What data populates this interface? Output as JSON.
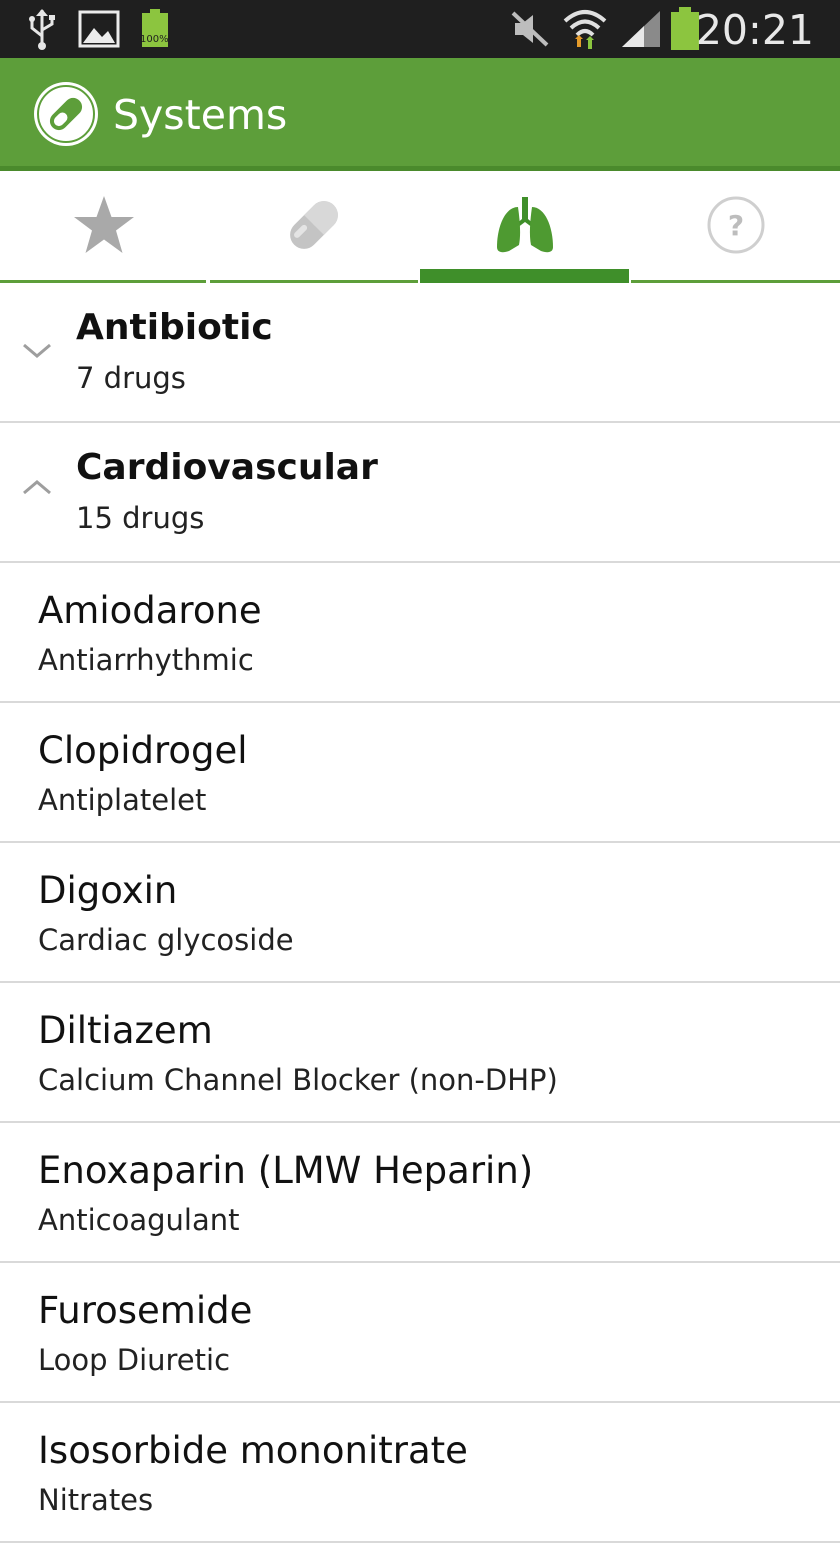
{
  "status_bar": {
    "time": "20:21",
    "battery_small_label": "100%",
    "icons": [
      "usb-icon",
      "image-icon",
      "battery-small-icon",
      "mute-icon",
      "wifi-icon",
      "signal-icon",
      "battery-icon"
    ]
  },
  "action_bar": {
    "title": "Systems",
    "logo_icon": "pill-logo-icon",
    "color": "#5d9e3a"
  },
  "tabs": [
    {
      "icon": "star-icon",
      "active": false
    },
    {
      "icon": "pill-icon",
      "active": false
    },
    {
      "icon": "lungs-icon",
      "active": true
    },
    {
      "icon": "help-icon",
      "active": false
    }
  ],
  "groups": [
    {
      "title": "Antibiotic",
      "count": "7 drugs",
      "expanded": false
    },
    {
      "title": "Cardiovascular",
      "count": "15 drugs",
      "expanded": true
    }
  ],
  "drugs": [
    {
      "name": "Amiodarone",
      "class": "Antiarrhythmic"
    },
    {
      "name": "Clopidrogel",
      "class": "Antiplatelet"
    },
    {
      "name": "Digoxin",
      "class": "Cardiac glycoside"
    },
    {
      "name": "Diltiazem",
      "class": "Calcium Channel Blocker (non-DHP)"
    },
    {
      "name": "Enoxaparin (LMW Heparin)",
      "class": "Anticoagulant"
    },
    {
      "name": "Furosemide",
      "class": "Loop Diuretic"
    },
    {
      "name": "Isosorbide mononitrate",
      "class": "Nitrates"
    }
  ]
}
